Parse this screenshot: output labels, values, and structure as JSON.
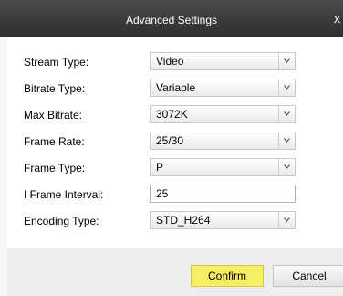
{
  "dialog": {
    "title": "Advanced Settings",
    "close_glyph": "x"
  },
  "fields": {
    "stream_type": {
      "label": "Stream Type:",
      "value": "Video"
    },
    "bitrate_type": {
      "label": "Bitrate Type:",
      "value": "Variable"
    },
    "max_bitrate": {
      "label": "Max Bitrate:",
      "value": "3072K"
    },
    "frame_rate": {
      "label": "Frame Rate:",
      "value": "25/30"
    },
    "frame_type": {
      "label": "Frame Type:",
      "value": "P"
    },
    "i_frame_interval": {
      "label": "I Frame Interval:",
      "value": "25"
    },
    "encoding_type": {
      "label": "Encoding Type:",
      "value": "STD_H264"
    }
  },
  "buttons": {
    "confirm": "Confirm",
    "cancel": "Cancel"
  },
  "colors": {
    "titlebar": "#3a3a3a",
    "confirm_button": "#f6ef63",
    "footer": "#eeeeee"
  },
  "icons": {
    "dropdown": "chevron-down-icon",
    "close": "close-icon"
  }
}
